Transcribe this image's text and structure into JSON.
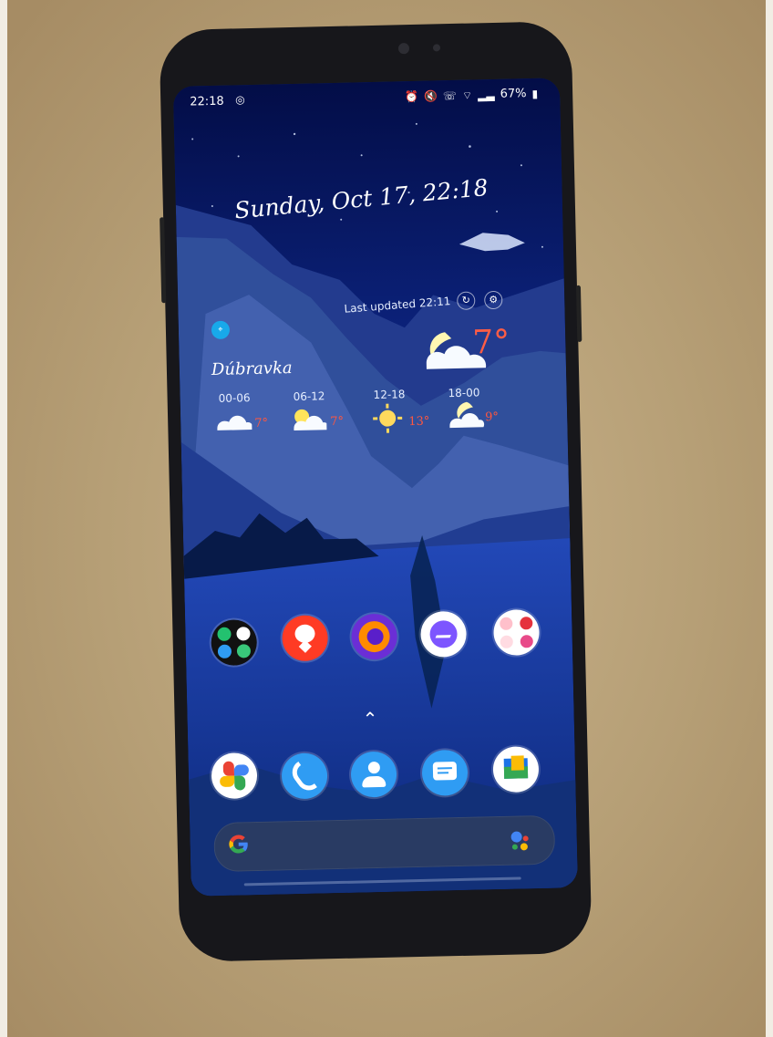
{
  "status_bar": {
    "time": "22:18",
    "battery": "67%"
  },
  "home_screen": {
    "date": "Sunday, Oct 17, 22:18",
    "weather": {
      "last_updated": "Last updated 22:11",
      "location": "Dúbravka",
      "current_temp": "7°",
      "forecast": [
        {
          "time": "00-06",
          "temp": "7°",
          "icon": "cloudy-night-icon"
        },
        {
          "time": "06-12",
          "temp": "7°",
          "icon": "partly-cloudy-icon"
        },
        {
          "time": "12-18",
          "temp": "13°",
          "icon": "sun-icon"
        },
        {
          "time": "18-00",
          "temp": "9°",
          "icon": "cloudy-night-icon"
        }
      ]
    },
    "apps": [
      {
        "name": "folder-google-apps",
        "color": "#2fd17b"
      },
      {
        "name": "maps-pin-app",
        "color": "#ff3b24"
      },
      {
        "name": "firefox-app",
        "color": "#ff8b00"
      },
      {
        "name": "messenger-app",
        "color": "#a033ff"
      },
      {
        "name": "folder-social-apps",
        "color": "#f04e7b"
      }
    ],
    "dock": [
      {
        "name": "photos-app",
        "color": "#ffffff"
      },
      {
        "name": "phone-app",
        "color": "#2f9cf3"
      },
      {
        "name": "contacts-app",
        "color": "#2f9cf3"
      },
      {
        "name": "messages-app",
        "color": "#2f9cf3"
      },
      {
        "name": "files-app",
        "color": "#ffffff"
      }
    ],
    "search_bar": {
      "logo": "G"
    }
  }
}
